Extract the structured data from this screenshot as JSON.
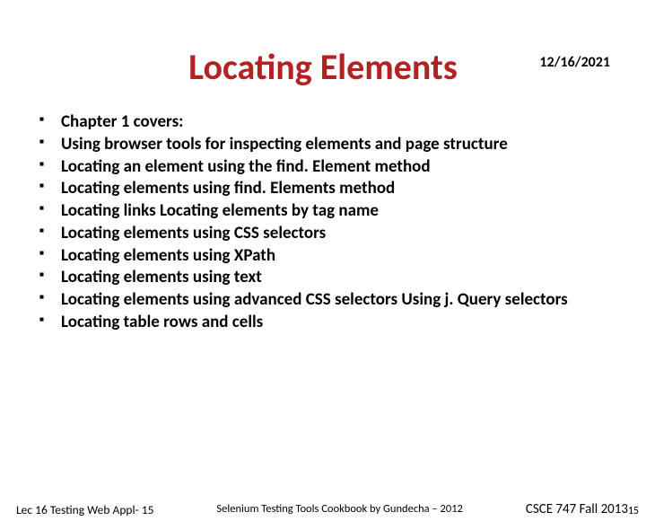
{
  "date": "12/16/2021",
  "title": "Locating Elements",
  "bullets": [
    "Chapter 1 covers:",
    "Using browser tools for inspecting elements and page structure",
    "Locating an element using the find. Element method",
    "Locating elements using find. Elements method",
    "Locating links Locating elements by tag name",
    "Locating elements using CSS selectors",
    "Locating elements using XPath",
    "Locating elements using text",
    "Locating elements using advanced CSS selectors Using j. Query selectors",
    "Locating table rows and cells"
  ],
  "footer": {
    "left": "Lec 16 Testing Web Appl- 15",
    "center": "Selenium Testing Tools Cookbook by Gundecha – 2012",
    "right": "CSCE 747 Fall 2013"
  },
  "pagenum": "15"
}
